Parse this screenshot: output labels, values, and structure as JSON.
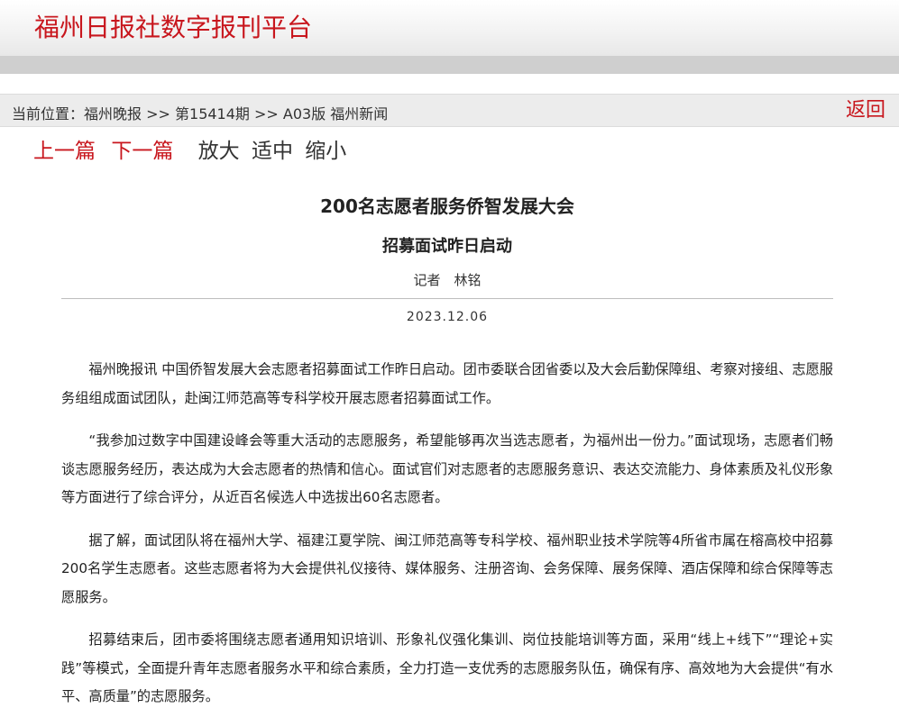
{
  "header": {
    "site_title": "福州日报社数字报刊平台"
  },
  "breadcrumb": {
    "prefix": "当前位置：",
    "paper": "福州晚报",
    "sep1": " >> ",
    "issue": "第15414期",
    "sep2": " >> ",
    "page": "A03版 福州新闻",
    "back_label": "返回"
  },
  "toolbar": {
    "prev": "上一篇",
    "next": "下一篇",
    "zoom_in": "放大",
    "zoom_fit": "适中",
    "zoom_out": "缩小"
  },
  "article": {
    "title": "200名志愿者服务侨智发展大会",
    "subtitle": "招募面试昨日启动",
    "author": "记者　林铭",
    "date": "2023.12.06",
    "paragraphs": [
      "福州晚报讯 中国侨智发展大会志愿者招募面试工作昨日启动。团市委联合团省委以及大会后勤保障组、考察对接组、志愿服务组组成面试团队，赴闽江师范高等专科学校开展志愿者招募面试工作。",
      "“我参加过数字中国建设峰会等重大活动的志愿服务，希望能够再次当选志愿者，为福州出一份力。”面试现场，志愿者们畅谈志愿服务经历，表达成为大会志愿者的热情和信心。面试官们对志愿者的志愿服务意识、表达交流能力、身体素质及礼仪形象等方面进行了综合评分，从近百名候选人中选拔出60名志愿者。",
      "据了解，面试团队将在福州大学、福建江夏学院、闽江师范高等专科学校、福州职业技术学院等4所省市属在榕高校中招募200名学生志愿者。这些志愿者将为大会提供礼仪接待、媒体服务、注册咨询、会务保障、展务保障、酒店保障和综合保障等志愿服务。",
      "招募结束后，团市委将围绕志愿者通用知识培训、形象礼仪强化集训、岗位技能培训等方面，采用“线上+线下”“理论+实践”等模式，全面提升青年志愿者服务水平和综合素质，全力打造一支优秀的志愿服务队伍，确保有序、高效地为大会提供“有水平、高质量”的志愿服务。"
    ]
  },
  "colors": {
    "accent_red": "#c8161d",
    "crumb_bg": "#ececec"
  }
}
